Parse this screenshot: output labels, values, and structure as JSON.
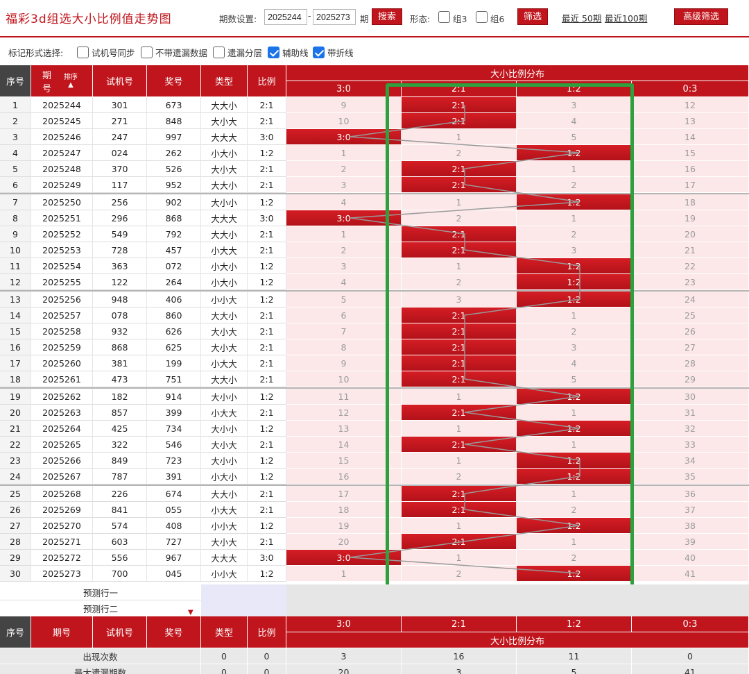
{
  "header": {
    "title": "福彩3d组选大小比例值走势图",
    "period_label": "期数设置:",
    "period_from": "2025244",
    "period_to": "2025273",
    "period_suffix": "期",
    "search_label": "搜索",
    "form_label": "形态:",
    "group3_label": "组3",
    "group6_label": "组6",
    "filter_label": "筛选",
    "recent50": "最近 50期",
    "recent100": "最近100期",
    "advanced_label": "高级筛选"
  },
  "options": {
    "label": "标记形式选择:",
    "items": [
      {
        "label": "试机号同步",
        "checked": false
      },
      {
        "label": "不带遗漏数据",
        "checked": false
      },
      {
        "label": "遗漏分层",
        "checked": false
      },
      {
        "label": "辅助线",
        "checked": true
      },
      {
        "label": "带折线",
        "checked": true
      }
    ]
  },
  "table": {
    "headers": {
      "seq": "序号",
      "period_a": "期",
      "period_b": "号",
      "sort": "排序",
      "trial": "试机号",
      "prize": "奖号",
      "type": "类型",
      "ratio": "比例",
      "dist": "大小比例分布",
      "cols": [
        "3:0",
        "2:1",
        "1:2",
        "0:3"
      ]
    },
    "rows": [
      {
        "seq": "1",
        "period": "2025244",
        "trial": "301",
        "prize": "673",
        "type": "大大小",
        "ratio": "2:1",
        "hit": 1,
        "vals": [
          "9",
          "2:1",
          "3",
          "12"
        ]
      },
      {
        "seq": "2",
        "period": "2025245",
        "trial": "271",
        "prize": "848",
        "type": "大小大",
        "ratio": "2:1",
        "hit": 1,
        "vals": [
          "10",
          "2:1",
          "4",
          "13"
        ]
      },
      {
        "seq": "3",
        "period": "2025246",
        "trial": "247",
        "prize": "997",
        "type": "大大大",
        "ratio": "3:0",
        "hit": 0,
        "vals": [
          "3:0",
          "1",
          "5",
          "14"
        ]
      },
      {
        "seq": "4",
        "period": "2025247",
        "trial": "024",
        "prize": "262",
        "type": "小大小",
        "ratio": "1:2",
        "hit": 2,
        "vals": [
          "1",
          "2",
          "1:2",
          "15"
        ]
      },
      {
        "seq": "5",
        "period": "2025248",
        "trial": "370",
        "prize": "526",
        "type": "大小大",
        "ratio": "2:1",
        "hit": 1,
        "vals": [
          "2",
          "2:1",
          "1",
          "16"
        ]
      },
      {
        "seq": "6",
        "period": "2025249",
        "trial": "117",
        "prize": "952",
        "type": "大大小",
        "ratio": "2:1",
        "hit": 1,
        "vals": [
          "3",
          "2:1",
          "2",
          "17"
        ]
      },
      {
        "seq": "7",
        "period": "2025250",
        "trial": "256",
        "prize": "902",
        "type": "大小小",
        "ratio": "1:2",
        "hit": 2,
        "vals": [
          "4",
          "1",
          "1:2",
          "18"
        ]
      },
      {
        "seq": "8",
        "period": "2025251",
        "trial": "296",
        "prize": "868",
        "type": "大大大",
        "ratio": "3:0",
        "hit": 0,
        "vals": [
          "3:0",
          "2",
          "1",
          "19"
        ]
      },
      {
        "seq": "9",
        "period": "2025252",
        "trial": "549",
        "prize": "792",
        "type": "大大小",
        "ratio": "2:1",
        "hit": 1,
        "vals": [
          "1",
          "2:1",
          "2",
          "20"
        ]
      },
      {
        "seq": "10",
        "period": "2025253",
        "trial": "728",
        "prize": "457",
        "type": "小大大",
        "ratio": "2:1",
        "hit": 1,
        "vals": [
          "2",
          "2:1",
          "3",
          "21"
        ]
      },
      {
        "seq": "11",
        "period": "2025254",
        "trial": "363",
        "prize": "072",
        "type": "小大小",
        "ratio": "1:2",
        "hit": 2,
        "vals": [
          "3",
          "1",
          "1:2",
          "22"
        ]
      },
      {
        "seq": "12",
        "period": "2025255",
        "trial": "122",
        "prize": "264",
        "type": "小大小",
        "ratio": "1:2",
        "hit": 2,
        "vals": [
          "4",
          "2",
          "1:2",
          "23"
        ]
      },
      {
        "seq": "13",
        "period": "2025256",
        "trial": "948",
        "prize": "406",
        "type": "小小大",
        "ratio": "1:2",
        "hit": 2,
        "vals": [
          "5",
          "3",
          "1:2",
          "24"
        ]
      },
      {
        "seq": "14",
        "period": "2025257",
        "trial": "078",
        "prize": "860",
        "type": "大大小",
        "ratio": "2:1",
        "hit": 1,
        "vals": [
          "6",
          "2:1",
          "1",
          "25"
        ]
      },
      {
        "seq": "15",
        "period": "2025258",
        "trial": "932",
        "prize": "626",
        "type": "大小大",
        "ratio": "2:1",
        "hit": 1,
        "vals": [
          "7",
          "2:1",
          "2",
          "26"
        ]
      },
      {
        "seq": "16",
        "period": "2025259",
        "trial": "868",
        "prize": "625",
        "type": "大小大",
        "ratio": "2:1",
        "hit": 1,
        "vals": [
          "8",
          "2:1",
          "3",
          "27"
        ]
      },
      {
        "seq": "17",
        "period": "2025260",
        "trial": "381",
        "prize": "199",
        "type": "小大大",
        "ratio": "2:1",
        "hit": 1,
        "vals": [
          "9",
          "2:1",
          "4",
          "28"
        ]
      },
      {
        "seq": "18",
        "period": "2025261",
        "trial": "473",
        "prize": "751",
        "type": "大大小",
        "ratio": "2:1",
        "hit": 1,
        "vals": [
          "10",
          "2:1",
          "5",
          "29"
        ]
      },
      {
        "seq": "19",
        "period": "2025262",
        "trial": "182",
        "prize": "914",
        "type": "大小小",
        "ratio": "1:2",
        "hit": 2,
        "vals": [
          "11",
          "1",
          "1:2",
          "30"
        ]
      },
      {
        "seq": "20",
        "period": "2025263",
        "trial": "857",
        "prize": "399",
        "type": "小大大",
        "ratio": "2:1",
        "hit": 1,
        "vals": [
          "12",
          "2:1",
          "1",
          "31"
        ]
      },
      {
        "seq": "21",
        "period": "2025264",
        "trial": "425",
        "prize": "734",
        "type": "大小小",
        "ratio": "1:2",
        "hit": 2,
        "vals": [
          "13",
          "1",
          "1:2",
          "32"
        ]
      },
      {
        "seq": "22",
        "period": "2025265",
        "trial": "322",
        "prize": "546",
        "type": "大小大",
        "ratio": "2:1",
        "hit": 1,
        "vals": [
          "14",
          "2:1",
          "1",
          "33"
        ]
      },
      {
        "seq": "23",
        "period": "2025266",
        "trial": "849",
        "prize": "723",
        "type": "大小小",
        "ratio": "1:2",
        "hit": 2,
        "vals": [
          "15",
          "1",
          "1:2",
          "34"
        ]
      },
      {
        "seq": "24",
        "period": "2025267",
        "trial": "787",
        "prize": "391",
        "type": "小大小",
        "ratio": "1:2",
        "hit": 2,
        "vals": [
          "16",
          "2",
          "1:2",
          "35"
        ]
      },
      {
        "seq": "25",
        "period": "2025268",
        "trial": "226",
        "prize": "674",
        "type": "大大小",
        "ratio": "2:1",
        "hit": 1,
        "vals": [
          "17",
          "2:1",
          "1",
          "36"
        ]
      },
      {
        "seq": "26",
        "period": "2025269",
        "trial": "841",
        "prize": "055",
        "type": "小大大",
        "ratio": "2:1",
        "hit": 1,
        "vals": [
          "18",
          "2:1",
          "2",
          "37"
        ]
      },
      {
        "seq": "27",
        "period": "2025270",
        "trial": "574",
        "prize": "408",
        "type": "小小大",
        "ratio": "1:2",
        "hit": 2,
        "vals": [
          "19",
          "1",
          "1:2",
          "38"
        ]
      },
      {
        "seq": "28",
        "period": "2025271",
        "trial": "603",
        "prize": "727",
        "type": "大小大",
        "ratio": "2:1",
        "hit": 1,
        "vals": [
          "20",
          "2:1",
          "1",
          "39"
        ]
      },
      {
        "seq": "29",
        "period": "2025272",
        "trial": "556",
        "prize": "967",
        "type": "大大大",
        "ratio": "3:0",
        "hit": 0,
        "vals": [
          "3:0",
          "1",
          "2",
          "40"
        ]
      },
      {
        "seq": "30",
        "period": "2025273",
        "trial": "700",
        "prize": "045",
        "type": "小小大",
        "ratio": "1:2",
        "hit": 2,
        "vals": [
          "1",
          "2",
          "1:2",
          "41"
        ]
      }
    ],
    "predict1": "预测行一",
    "predict2": "预测行二",
    "footer": {
      "seq": "序号",
      "period": "期号",
      "trial": "试机号",
      "prize": "奖号",
      "type": "类型",
      "ratio": "比例",
      "dist": "大小比例分布"
    },
    "stats": [
      {
        "label": "出现次数",
        "type": "0",
        "ratio": "0",
        "vals": [
          "3",
          "16",
          "11",
          "0"
        ]
      },
      {
        "label": "最大遗漏期数",
        "type": "0",
        "ratio": "0",
        "vals": [
          "20",
          "3",
          "5",
          "41"
        ]
      }
    ]
  },
  "colors": {
    "accent": "#c0151c",
    "highlight_box": "#2ea03e"
  }
}
